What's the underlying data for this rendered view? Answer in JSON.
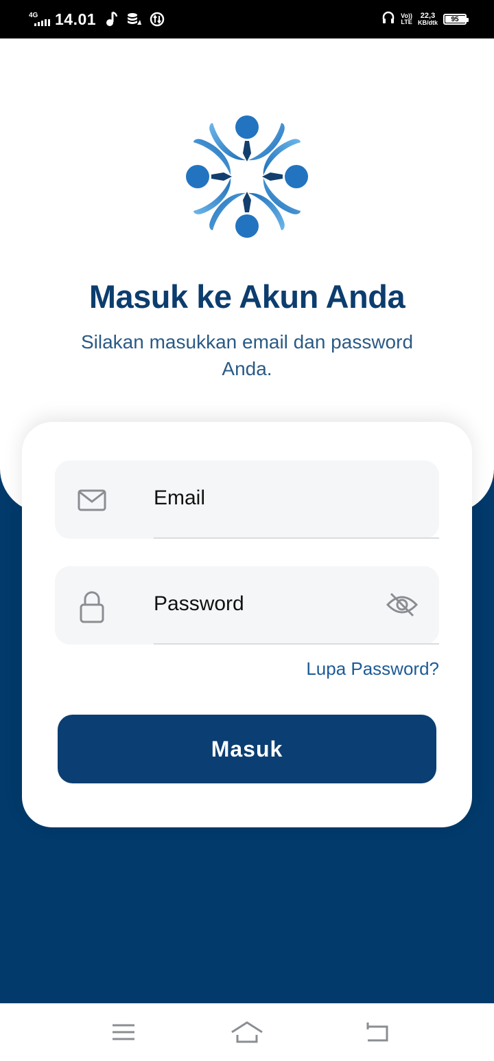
{
  "status_bar": {
    "network": "4G",
    "time": "14.01",
    "volte_line1": "Vo))",
    "volte_line2": "LTE",
    "speed_value": "22,3",
    "speed_unit": "KB/dtk",
    "battery": "95",
    "battery_level": 0.95
  },
  "login": {
    "title": "Masuk ke Akun Anda",
    "subtitle": "Silakan masukkan email dan password Anda.",
    "email_placeholder": "Email",
    "password_placeholder": "Password",
    "forgot_link": "Lupa Password?",
    "submit_label": "Masuk"
  },
  "icons": {
    "email_field": "envelope-icon",
    "password_field": "lock-icon",
    "password_toggle": "eye-off-icon",
    "nav_menu": "menu-icon",
    "nav_home": "home-icon",
    "nav_back": "back-icon"
  },
  "colors": {
    "primary": "#0b3e72",
    "background_navy": "#013a6b",
    "title": "#0c3d6e",
    "link": "#1d5b96",
    "logo_blue": "#2a7fc6"
  }
}
